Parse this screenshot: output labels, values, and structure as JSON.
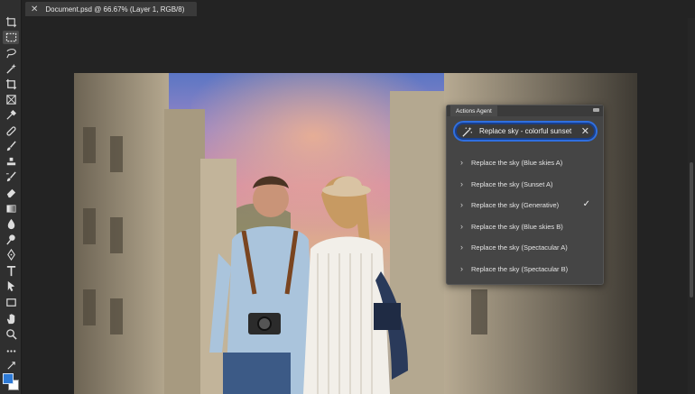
{
  "tab": {
    "title": "Document.psd @ 66.67% (Layer 1, RGB/8)",
    "close": "✕"
  },
  "tools": [
    "artboard-icon",
    "marquee-icon",
    "lasso-icon",
    "magic-wand-icon",
    "crop-icon",
    "frame-icon",
    "eyedropper-icon",
    "healing-icon",
    "brush-icon",
    "stamp-icon",
    "history-brush-icon",
    "eraser-icon",
    "gradient-icon",
    "blur-icon",
    "dodge-icon",
    "pen-icon",
    "type-icon",
    "path-select-icon",
    "rectangle-icon",
    "hand-icon",
    "zoom-icon",
    "more-tools-icon"
  ],
  "colors": {
    "foreground": "#2d7ad6",
    "background": "#ffffff",
    "accent": "#2f6fe0"
  },
  "panel": {
    "tab_label": "Actions Agent",
    "prompt": "Replace sky - colorful sunset",
    "clear": "✕",
    "selected_index": 2,
    "actions": [
      "Replace the sky (Blue skies A)",
      "Replace the sky (Sunset A)",
      "Replace the sky (Generative)",
      "Replace the sky (Blue skies B)",
      "Replace the sky (Spectacular A)",
      "Replace the sky (Spectacular B)"
    ],
    "check_mark": "✓"
  }
}
